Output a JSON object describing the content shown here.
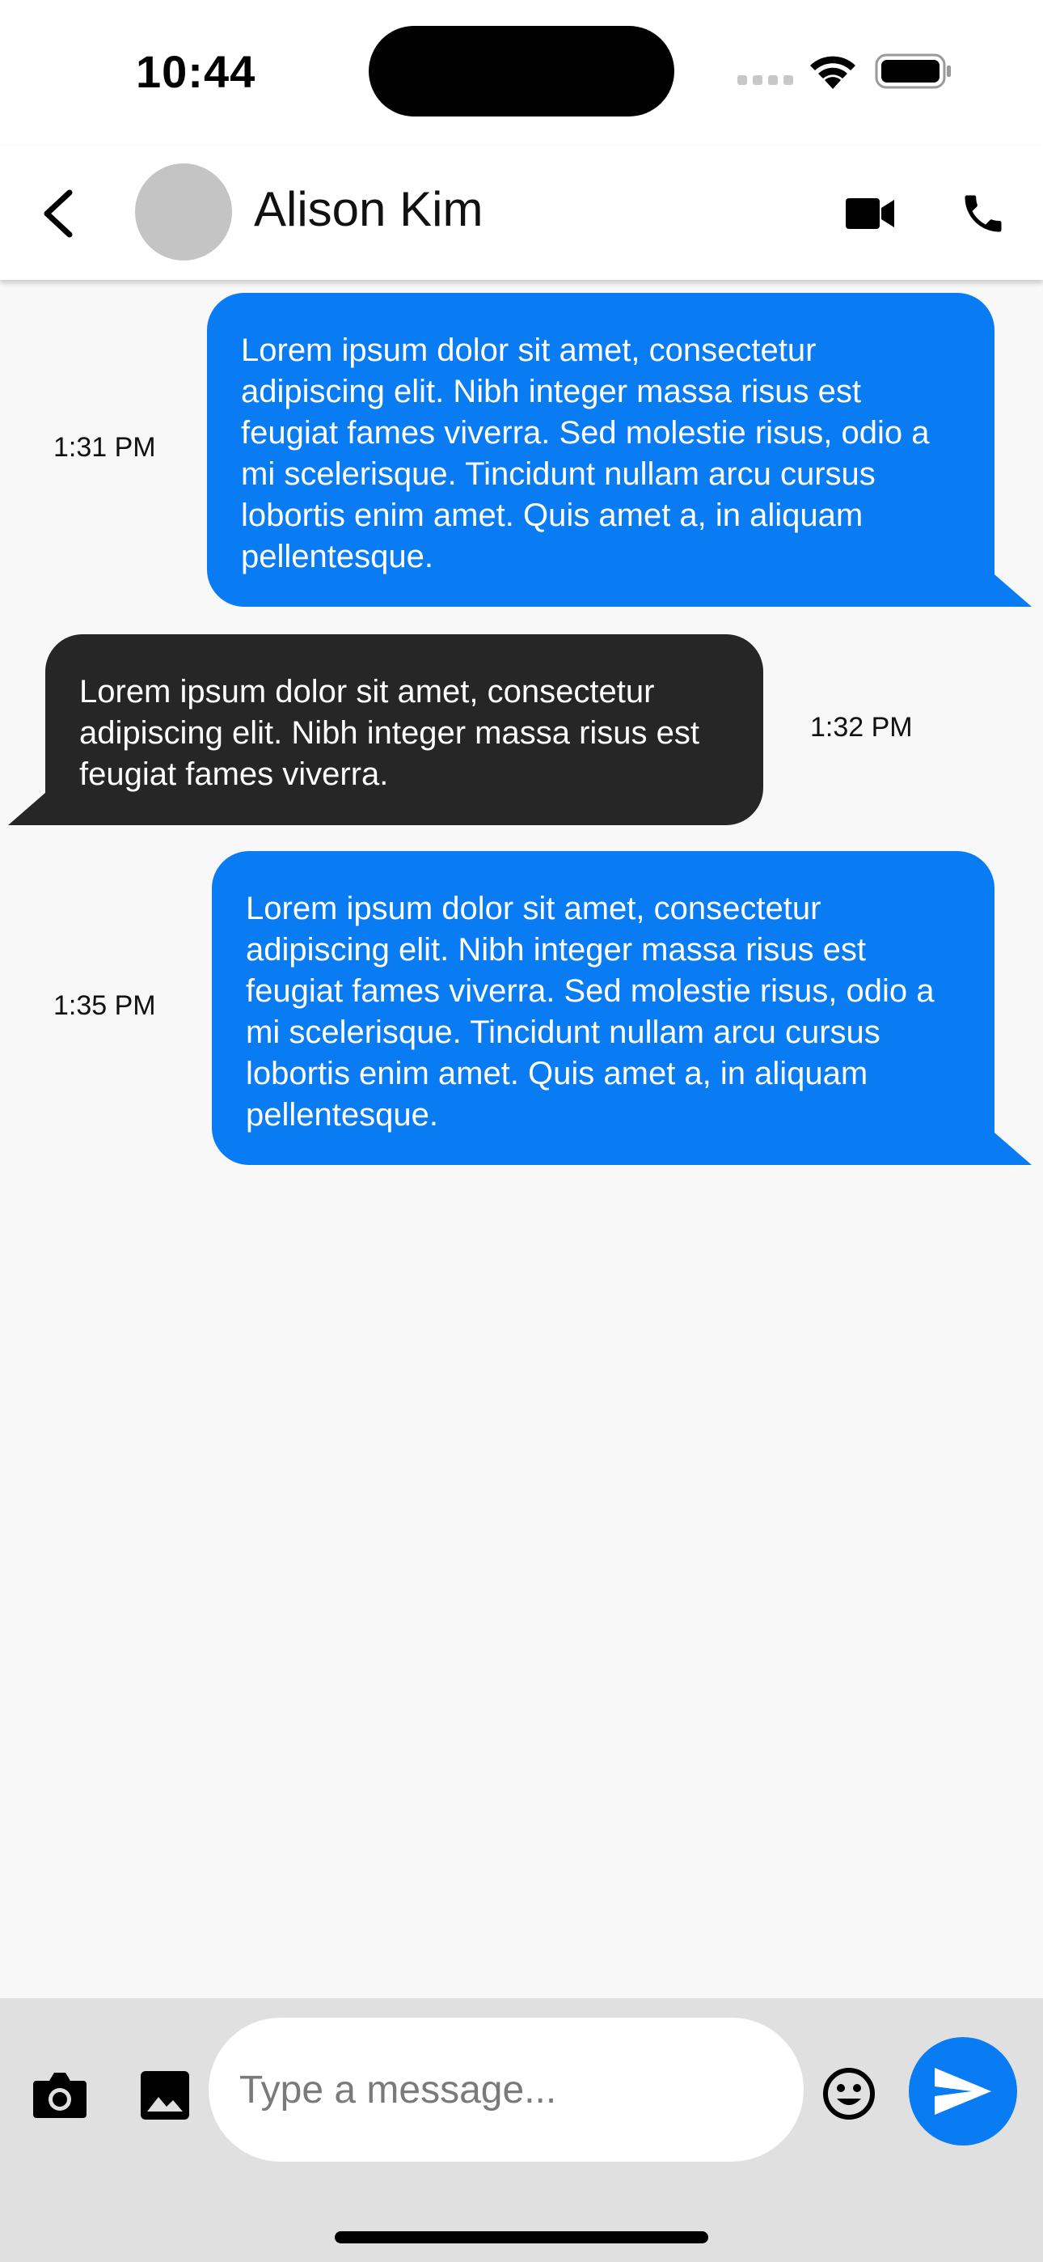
{
  "status_bar": {
    "time": "10:44",
    "icons": [
      "signal-icon",
      "wifi-icon",
      "battery-icon"
    ]
  },
  "header": {
    "back_icon": "chevron-left-icon",
    "contact_name": "Alison Kim",
    "video_icon": "video-camera-icon",
    "phone_icon": "phone-icon"
  },
  "messages": [
    {
      "direction": "sent",
      "text": "Lorem ipsum dolor sit amet, consectetur adipiscing elit. Nibh integer massa risus est feugiat fames viverra. Sed molestie risus, odio a mi scelerisque. Tincidunt nullam arcu cursus lobortis enim amet. Quis amet a, in aliquam pellentesque.",
      "time": "1:31 PM"
    },
    {
      "direction": "received",
      "text": "Lorem ipsum dolor sit amet, consectetur adipiscing elit. Nibh integer massa risus est feugiat fames viverra.",
      "time": "1:32 PM"
    },
    {
      "direction": "sent",
      "text": "Lorem ipsum dolor sit amet, consectetur adipiscing elit. Nibh integer massa risus est feugiat fames viverra. Sed molestie risus, odio a mi scelerisque. Tincidunt nullam arcu cursus lobortis enim amet. Quis amet a, in aliquam pellentesque.",
      "time": "1:35 PM"
    }
  ],
  "composer": {
    "camera_icon": "camera-icon",
    "gallery_icon": "image-icon",
    "placeholder": "Type a message...",
    "value": "",
    "emoji_icon": "emoji-icon",
    "send_icon": "send-icon"
  },
  "colors": {
    "sent_bubble": "#0a7cf3",
    "received_bubble": "#262626",
    "accent": "#0a7cf3",
    "composer_background": "#e0e0e0",
    "chat_background": "#f8f8f8"
  }
}
